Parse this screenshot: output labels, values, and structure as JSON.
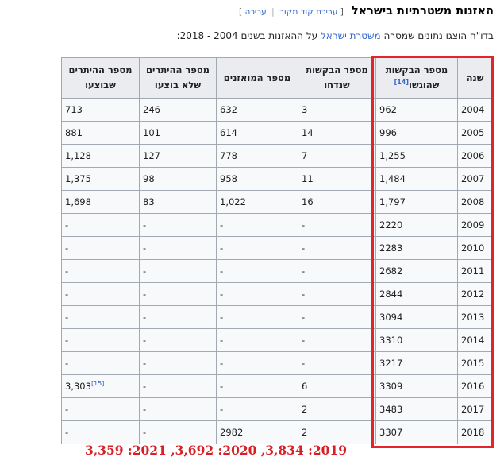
{
  "heading": {
    "title": "האזנות משטרתיות בישראל",
    "bracket_open": "[",
    "edit_source": "עריכת קוד מקור",
    "separator": "|",
    "edit": "עריכה",
    "bracket_close": "]"
  },
  "intro": {
    "before": "בדו\"ח הוצגו נתונים שמסרה ",
    "link": "משטרת ישראל",
    "after": " על ההאזנות בשנים 2004 - 2018:"
  },
  "table": {
    "headers": [
      {
        "label": "שנה"
      },
      {
        "label": "מספר הבקשות שהוגשו",
        "ref": "[14]"
      },
      {
        "label": "מספר הבקשות שנדחו"
      },
      {
        "label": "מספר המואזנים"
      },
      {
        "label": "מספר ההיתרים שלא בוצעו"
      },
      {
        "label": "מספר ההיתרים שבוצעו"
      }
    ],
    "rows": [
      {
        "year": "2004",
        "submitted": "962",
        "rejected": "3",
        "monitored": "632",
        "not_executed": "246",
        "executed": "713"
      },
      {
        "year": "2005",
        "submitted": "996",
        "rejected": "14",
        "monitored": "614",
        "not_executed": "101",
        "executed": "881"
      },
      {
        "year": "2006",
        "submitted": "1,255",
        "rejected": "7",
        "monitored": "778",
        "not_executed": "127",
        "executed": "1,128"
      },
      {
        "year": "2007",
        "submitted": "1,484",
        "rejected": "11",
        "monitored": "958",
        "not_executed": "98",
        "executed": "1,375"
      },
      {
        "year": "2008",
        "submitted": "1,797",
        "rejected": "16",
        "monitored": "1,022",
        "not_executed": "83",
        "executed": "1,698"
      },
      {
        "year": "2009",
        "submitted": "2220",
        "rejected": "-",
        "monitored": "-",
        "not_executed": "-",
        "executed": "-"
      },
      {
        "year": "2010",
        "submitted": "2283",
        "rejected": "-",
        "monitored": "-",
        "not_executed": "-",
        "executed": "-"
      },
      {
        "year": "2011",
        "submitted": "2682",
        "rejected": "-",
        "monitored": "-",
        "not_executed": "-",
        "executed": "-"
      },
      {
        "year": "2012",
        "submitted": "2844",
        "rejected": "-",
        "monitored": "-",
        "not_executed": "-",
        "executed": "-"
      },
      {
        "year": "2013",
        "submitted": "3094",
        "rejected": "-",
        "monitored": "-",
        "not_executed": "-",
        "executed": "-"
      },
      {
        "year": "2014",
        "submitted": "3310",
        "rejected": "-",
        "monitored": "-",
        "not_executed": "-",
        "executed": "-"
      },
      {
        "year": "2015",
        "submitted": "3217",
        "rejected": "-",
        "monitored": "-",
        "not_executed": "-",
        "executed": "-"
      },
      {
        "year": "2016",
        "submitted": "3309",
        "rejected": "6",
        "monitored": "-",
        "not_executed": "-",
        "executed": "3,303",
        "executed_ref": "[15]"
      },
      {
        "year": "2017",
        "submitted": "3483",
        "rejected": "2",
        "monitored": "-",
        "not_executed": "-",
        "executed": "-"
      },
      {
        "year": "2018",
        "submitted": "3307",
        "rejected": "2",
        "monitored": "2982",
        "not_executed": "-",
        "executed": "-"
      }
    ]
  },
  "annotation": {
    "text": "2019: 3,834, 2020: 3,692, 2021: 3,359",
    "color": "#d81f26",
    "box_color": "#e3242b"
  },
  "colors": {
    "link": "#3366cc",
    "header_bg": "#eaecf0",
    "cell_bg": "#f8f9fa",
    "border": "#a2a9b1"
  }
}
